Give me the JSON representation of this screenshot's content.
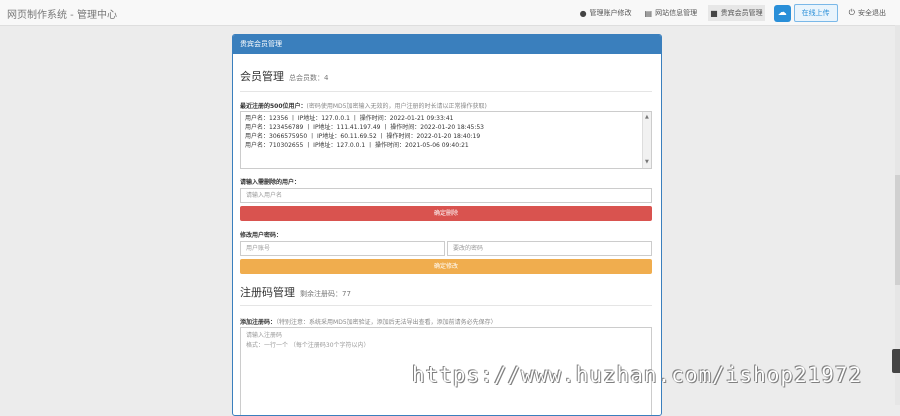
{
  "app": {
    "title": "网页制作系统 - 管理中心"
  },
  "nav": {
    "items": [
      {
        "label": "管理账户修改",
        "icon": "user-icon"
      },
      {
        "label": "网站信息管理",
        "icon": "document-icon"
      },
      {
        "label": "贵宾会员管理",
        "icon": "chat-icon"
      }
    ],
    "upload_label": "在线上传",
    "logout_label": "安全退出"
  },
  "panel": {
    "header": "贵宾会员管理",
    "members": {
      "title": "会员管理",
      "total": "总会员数：4",
      "list_label": "最近注册的500位用户：",
      "list_hint": "(密码使用MD5加密输入无效的，用户注册的时长请以正常操作获取)",
      "users": [
        "用户名：12356  丨  IP地址：127.0.0.1  丨  操作时间：2022-01-21 09:33:41",
        "用户名：123456789  丨  IP地址：111.41.197.49  丨  操作时间：2022-01-20 18:45:53",
        "用户名：3066575950  丨  IP地址：60.11.69.52  丨  操作时间：2022-01-20 18:40:19",
        "用户名：710302655  丨  IP地址：127.0.0.1  丨  操作时间：2021-05-06 09:40:21"
      ],
      "delete_label": "请输入需删除的用户：",
      "delete_placeholder": "请输入用户名",
      "delete_button": "确定删除",
      "modify_label": "修改用户密码：",
      "modify_user_placeholder": "用户账号",
      "modify_pwd_placeholder": "要改的密码",
      "modify_button": "确定修改"
    },
    "codes": {
      "title": "注册码管理",
      "remaining": "剩余注册码：77",
      "add_label": "添加注册码：",
      "add_hint": "（特别注意：系统采用MD5加密验证，添加后无法导出查看，添加前请务必先保存）",
      "textarea_placeholder_1": "请输入注册码",
      "textarea_placeholder_2": "格式：一行一个 （每个注册码30个字符以内）"
    }
  },
  "watermark": "https://www.huzhan.com/ishop21972",
  "colors": {
    "primary": "#3a7fbd",
    "danger": "#d9534f",
    "warning": "#f0ad4e"
  }
}
